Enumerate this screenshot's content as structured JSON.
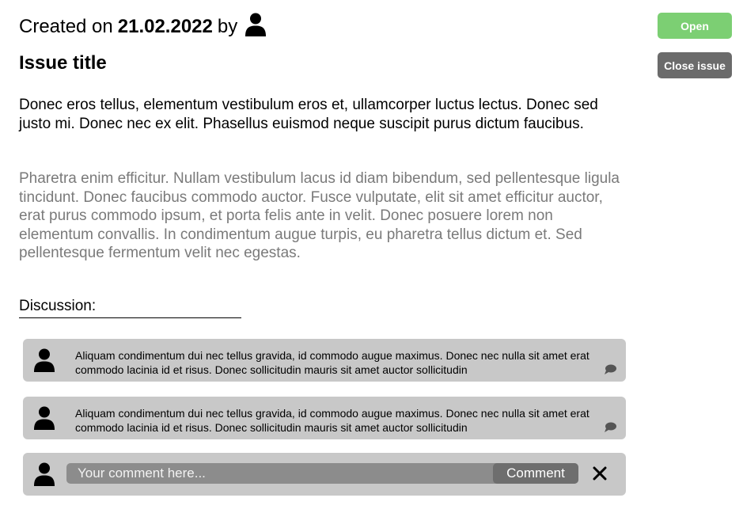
{
  "issue": {
    "created_prefix": "Created on",
    "created_date": "21.02.2022",
    "created_by": "by",
    "author_icon": "user-icon",
    "title": "Issue title",
    "description_primary": "Donec eros tellus, elementum vestibulum eros et, ullamcorper luctus lectus. Donec sed justo mi. Donec nec ex elit. Phasellus euismod neque suscipit purus dictum faucibus.",
    "description_secondary": "Pharetra enim efficitur. Nullam vestibulum lacus id diam bibendum, sed pellentesque ligula tincidunt. Donec faucibus commodo auctor. Fusce vulputate, elit sit amet efficitur auctor, erat purus commodo ipsum, et porta felis ante in velit. Donec posuere lorem non elementum convallis. In condimentum augue turpis, eu pharetra tellus dictum et. Sed pellentesque fermentum velit nec egestas."
  },
  "actions": {
    "status_label": "Open",
    "status_color": "#7ccf73",
    "close_label": "Close issue",
    "close_color": "#6b6b6b"
  },
  "discussion": {
    "heading": "Discussion:",
    "comments": [
      {
        "text": "Aliquam condimentum dui nec tellus gravida, id commodo augue maximus. Donec nec nulla sit amet erat commodo lacinia id et risus. Donec sollicitudin mauris sit amet auctor sollicitudin",
        "avatar_icon": "user-icon",
        "reply_icon": "speech-bubble-icon"
      },
      {
        "text": "Aliquam condimentum dui nec tellus gravida, id commodo augue maximus. Donec nec nulla sit amet erat commodo lacinia id et risus. Donec sollicitudin mauris sit amet auctor sollicitudin",
        "avatar_icon": "user-icon",
        "reply_icon": "speech-bubble-icon"
      }
    ],
    "composer": {
      "placeholder": "Your comment here...",
      "value": "",
      "submit_label": "Comment",
      "cancel_icon": "close-icon"
    }
  }
}
